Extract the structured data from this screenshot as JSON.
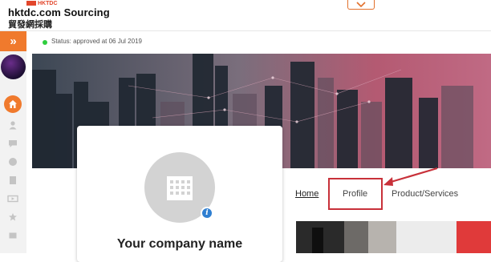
{
  "brand": {
    "small_logo": "HKTDC",
    "name": "hktdc.com Sourcing",
    "name_cn": "貿發網採購"
  },
  "status": {
    "text": "Status: approved at 06 Jul 2019",
    "color": "#2fce3e"
  },
  "colors": {
    "accent": "#f07a2d",
    "highlight": "#c8313a"
  },
  "sidebar": {
    "expand_glyph": "»",
    "icons": [
      "home-icon",
      "user-icon",
      "chat-icon",
      "globe-icon",
      "document-icon",
      "video-icon",
      "star-icon",
      "book-icon"
    ]
  },
  "company": {
    "name": "Your company name"
  },
  "tabs": [
    {
      "label": "Home"
    },
    {
      "label": "Profile"
    },
    {
      "label": "Product/Services"
    }
  ]
}
